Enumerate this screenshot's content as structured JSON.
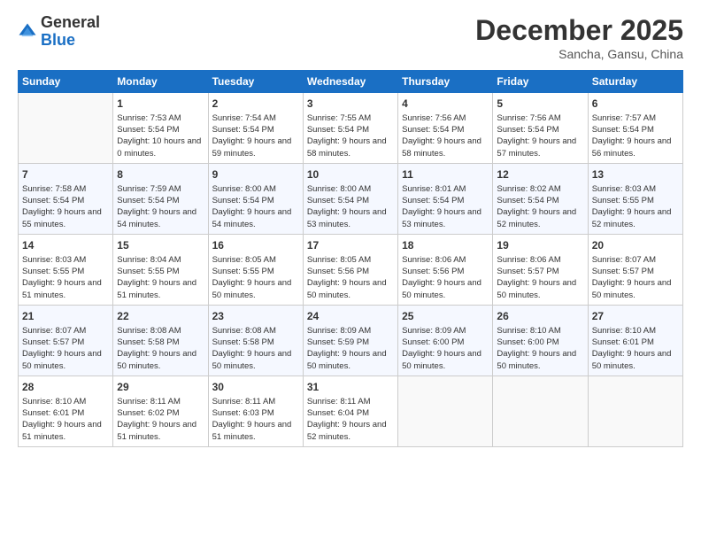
{
  "header": {
    "logo_general": "General",
    "logo_blue": "Blue",
    "month_title": "December 2025",
    "subtitle": "Sancha, Gansu, China"
  },
  "calendar": {
    "days_of_week": [
      "Sunday",
      "Monday",
      "Tuesday",
      "Wednesday",
      "Thursday",
      "Friday",
      "Saturday"
    ],
    "weeks": [
      [
        {
          "day": "",
          "sunrise": "",
          "sunset": "",
          "daylight": ""
        },
        {
          "day": "1",
          "sunrise": "Sunrise: 7:53 AM",
          "sunset": "Sunset: 5:54 PM",
          "daylight": "Daylight: 10 hours and 0 minutes."
        },
        {
          "day": "2",
          "sunrise": "Sunrise: 7:54 AM",
          "sunset": "Sunset: 5:54 PM",
          "daylight": "Daylight: 9 hours and 59 minutes."
        },
        {
          "day": "3",
          "sunrise": "Sunrise: 7:55 AM",
          "sunset": "Sunset: 5:54 PM",
          "daylight": "Daylight: 9 hours and 58 minutes."
        },
        {
          "day": "4",
          "sunrise": "Sunrise: 7:56 AM",
          "sunset": "Sunset: 5:54 PM",
          "daylight": "Daylight: 9 hours and 58 minutes."
        },
        {
          "day": "5",
          "sunrise": "Sunrise: 7:56 AM",
          "sunset": "Sunset: 5:54 PM",
          "daylight": "Daylight: 9 hours and 57 minutes."
        },
        {
          "day": "6",
          "sunrise": "Sunrise: 7:57 AM",
          "sunset": "Sunset: 5:54 PM",
          "daylight": "Daylight: 9 hours and 56 minutes."
        }
      ],
      [
        {
          "day": "7",
          "sunrise": "Sunrise: 7:58 AM",
          "sunset": "Sunset: 5:54 PM",
          "daylight": "Daylight: 9 hours and 55 minutes."
        },
        {
          "day": "8",
          "sunrise": "Sunrise: 7:59 AM",
          "sunset": "Sunset: 5:54 PM",
          "daylight": "Daylight: 9 hours and 54 minutes."
        },
        {
          "day": "9",
          "sunrise": "Sunrise: 8:00 AM",
          "sunset": "Sunset: 5:54 PM",
          "daylight": "Daylight: 9 hours and 54 minutes."
        },
        {
          "day": "10",
          "sunrise": "Sunrise: 8:00 AM",
          "sunset": "Sunset: 5:54 PM",
          "daylight": "Daylight: 9 hours and 53 minutes."
        },
        {
          "day": "11",
          "sunrise": "Sunrise: 8:01 AM",
          "sunset": "Sunset: 5:54 PM",
          "daylight": "Daylight: 9 hours and 53 minutes."
        },
        {
          "day": "12",
          "sunrise": "Sunrise: 8:02 AM",
          "sunset": "Sunset: 5:54 PM",
          "daylight": "Daylight: 9 hours and 52 minutes."
        },
        {
          "day": "13",
          "sunrise": "Sunrise: 8:03 AM",
          "sunset": "Sunset: 5:55 PM",
          "daylight": "Daylight: 9 hours and 52 minutes."
        }
      ],
      [
        {
          "day": "14",
          "sunrise": "Sunrise: 8:03 AM",
          "sunset": "Sunset: 5:55 PM",
          "daylight": "Daylight: 9 hours and 51 minutes."
        },
        {
          "day": "15",
          "sunrise": "Sunrise: 8:04 AM",
          "sunset": "Sunset: 5:55 PM",
          "daylight": "Daylight: 9 hours and 51 minutes."
        },
        {
          "day": "16",
          "sunrise": "Sunrise: 8:05 AM",
          "sunset": "Sunset: 5:55 PM",
          "daylight": "Daylight: 9 hours and 50 minutes."
        },
        {
          "day": "17",
          "sunrise": "Sunrise: 8:05 AM",
          "sunset": "Sunset: 5:56 PM",
          "daylight": "Daylight: 9 hours and 50 minutes."
        },
        {
          "day": "18",
          "sunrise": "Sunrise: 8:06 AM",
          "sunset": "Sunset: 5:56 PM",
          "daylight": "Daylight: 9 hours and 50 minutes."
        },
        {
          "day": "19",
          "sunrise": "Sunrise: 8:06 AM",
          "sunset": "Sunset: 5:57 PM",
          "daylight": "Daylight: 9 hours and 50 minutes."
        },
        {
          "day": "20",
          "sunrise": "Sunrise: 8:07 AM",
          "sunset": "Sunset: 5:57 PM",
          "daylight": "Daylight: 9 hours and 50 minutes."
        }
      ],
      [
        {
          "day": "21",
          "sunrise": "Sunrise: 8:07 AM",
          "sunset": "Sunset: 5:57 PM",
          "daylight": "Daylight: 9 hours and 50 minutes."
        },
        {
          "day": "22",
          "sunrise": "Sunrise: 8:08 AM",
          "sunset": "Sunset: 5:58 PM",
          "daylight": "Daylight: 9 hours and 50 minutes."
        },
        {
          "day": "23",
          "sunrise": "Sunrise: 8:08 AM",
          "sunset": "Sunset: 5:58 PM",
          "daylight": "Daylight: 9 hours and 50 minutes."
        },
        {
          "day": "24",
          "sunrise": "Sunrise: 8:09 AM",
          "sunset": "Sunset: 5:59 PM",
          "daylight": "Daylight: 9 hours and 50 minutes."
        },
        {
          "day": "25",
          "sunrise": "Sunrise: 8:09 AM",
          "sunset": "Sunset: 6:00 PM",
          "daylight": "Daylight: 9 hours and 50 minutes."
        },
        {
          "day": "26",
          "sunrise": "Sunrise: 8:10 AM",
          "sunset": "Sunset: 6:00 PM",
          "daylight": "Daylight: 9 hours and 50 minutes."
        },
        {
          "day": "27",
          "sunrise": "Sunrise: 8:10 AM",
          "sunset": "Sunset: 6:01 PM",
          "daylight": "Daylight: 9 hours and 50 minutes."
        }
      ],
      [
        {
          "day": "28",
          "sunrise": "Sunrise: 8:10 AM",
          "sunset": "Sunset: 6:01 PM",
          "daylight": "Daylight: 9 hours and 51 minutes."
        },
        {
          "day": "29",
          "sunrise": "Sunrise: 8:11 AM",
          "sunset": "Sunset: 6:02 PM",
          "daylight": "Daylight: 9 hours and 51 minutes."
        },
        {
          "day": "30",
          "sunrise": "Sunrise: 8:11 AM",
          "sunset": "Sunset: 6:03 PM",
          "daylight": "Daylight: 9 hours and 51 minutes."
        },
        {
          "day": "31",
          "sunrise": "Sunrise: 8:11 AM",
          "sunset": "Sunset: 6:04 PM",
          "daylight": "Daylight: 9 hours and 52 minutes."
        },
        {
          "day": "",
          "sunrise": "",
          "sunset": "",
          "daylight": ""
        },
        {
          "day": "",
          "sunrise": "",
          "sunset": "",
          "daylight": ""
        },
        {
          "day": "",
          "sunrise": "",
          "sunset": "",
          "daylight": ""
        }
      ]
    ]
  }
}
